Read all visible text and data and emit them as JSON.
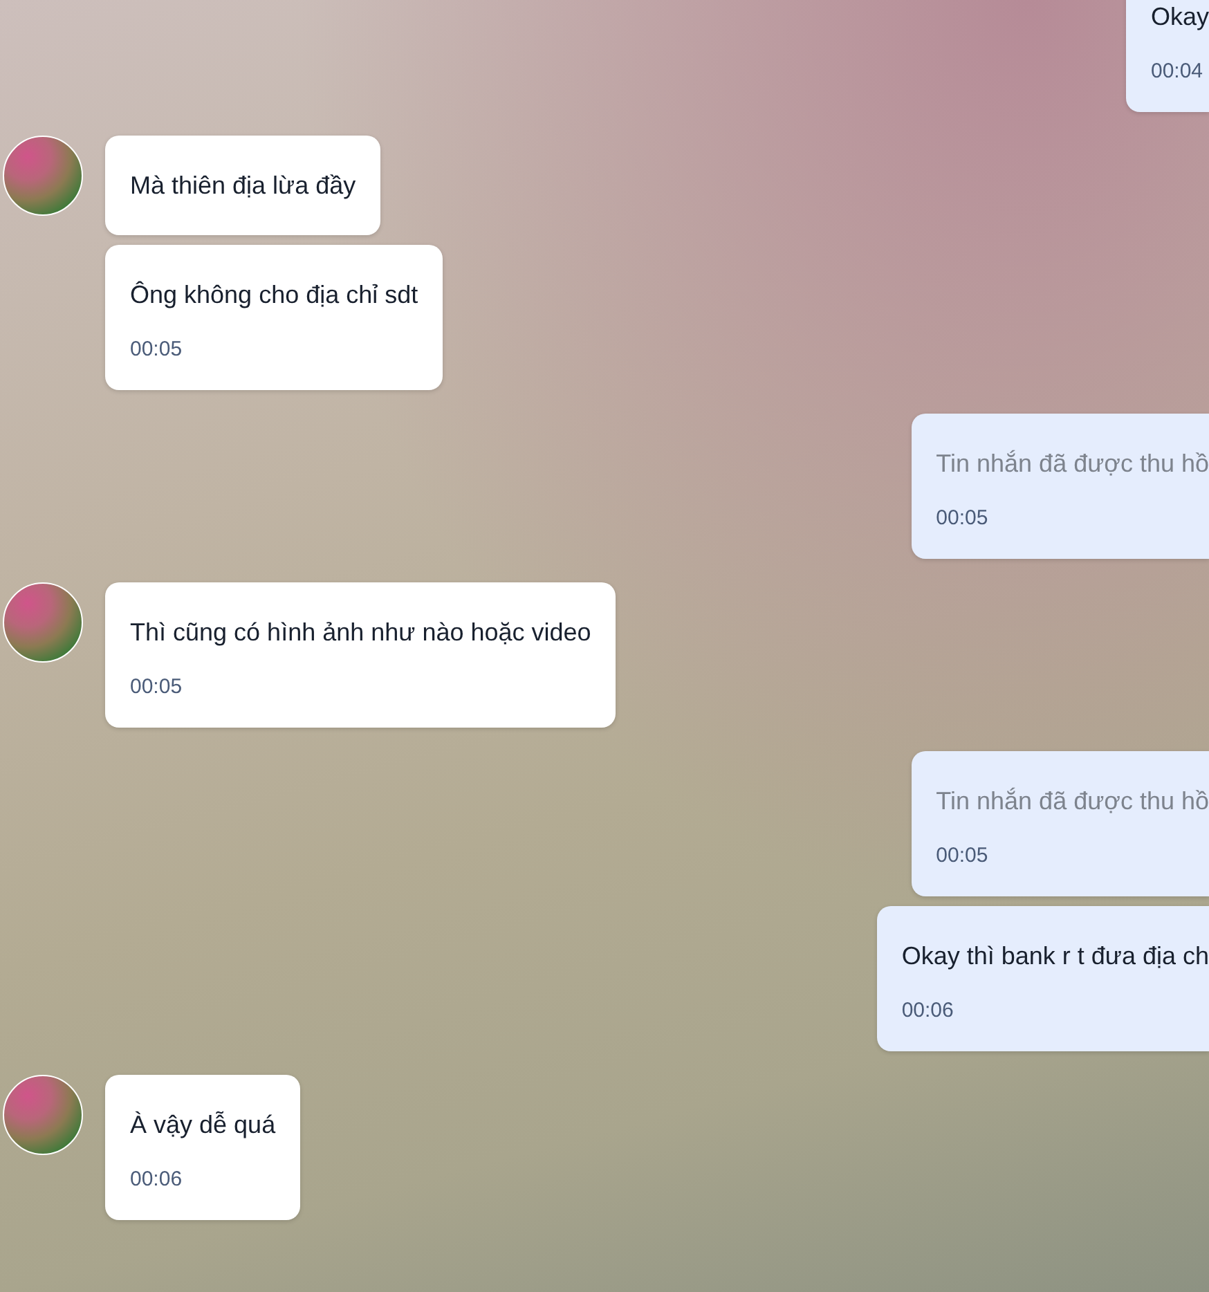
{
  "groups": [
    {
      "kind": "outgoing",
      "messages": [
        {
          "kind": "text",
          "text": "Okay",
          "time": "00:04"
        }
      ]
    },
    {
      "kind": "incoming",
      "messages": [
        {
          "kind": "text",
          "text": "Mà thiên địa lừa đầy"
        },
        {
          "kind": "text",
          "text": "Ông không cho địa chỉ sdt",
          "time": "00:05"
        }
      ]
    },
    {
      "kind": "outgoing",
      "messages": [
        {
          "kind": "recalled",
          "text": "Tin nhắn đã được thu hồ",
          "time": "00:05"
        }
      ]
    },
    {
      "kind": "incoming",
      "messages": [
        {
          "kind": "text",
          "text": "Thì cũng có hình ảnh như nào hoặc video",
          "time": "00:05"
        }
      ]
    },
    {
      "kind": "outgoing",
      "messages": [
        {
          "kind": "recalled",
          "text": "Tin nhắn đã được thu hồ",
          "time": "00:05"
        },
        {
          "kind": "text",
          "text": "Okay thì bank r t đưa địa ch",
          "time": "00:06"
        }
      ]
    },
    {
      "kind": "incoming",
      "messages": [
        {
          "kind": "text",
          "text": "À vậy dễ quá",
          "time": "00:06"
        }
      ]
    }
  ]
}
